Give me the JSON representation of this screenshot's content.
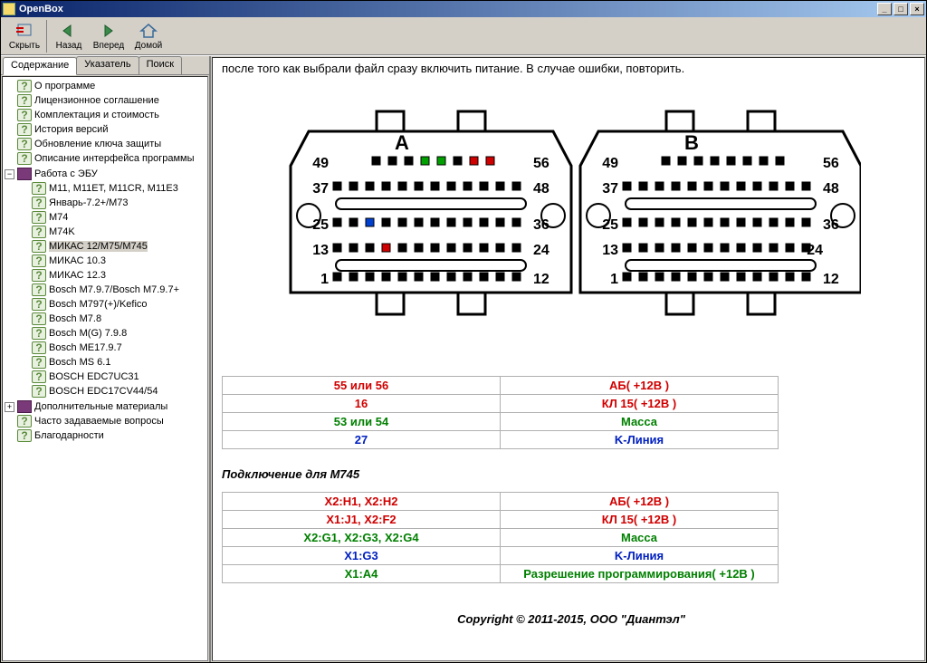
{
  "window": {
    "title": "OpenBox"
  },
  "toolbar": {
    "hide": "Скрыть",
    "back": "Назад",
    "forward": "Вперед",
    "home": "Домой"
  },
  "tabs": {
    "contents": "Содержание",
    "index": "Указатель",
    "search": "Поиск"
  },
  "tree": {
    "about": "О программе",
    "license": "Лицензионное соглашение",
    "pricing": "Комплектация и стоимость",
    "history": "История версий",
    "keyupdate": "Обновление ключа защиты",
    "interface": "Описание интерфейса программы",
    "ecu": "Работа с ЭБУ",
    "m11": "M11, M11ET, M11CR, M11E3",
    "yanvar": "Январь-7.2+/M73",
    "m74": "M74",
    "m74k": "M74K",
    "mikas12": "МИКАС 12/M75/M745",
    "mikas103": "МИКАС 10.3",
    "mikas123": "МИКАС 12.3",
    "bosch797": "Bosch M7.9.7/Bosch M7.9.7+",
    "bosch797k": "Bosch M797(+)/Kefico",
    "boschm78": "Bosch M7.8",
    "boschmg": "Bosch M(G) 7.9.8",
    "boschme": "Bosch ME17.9.7",
    "boschms": "Bosch MS 6.1",
    "edc7": "BOSCH EDC7UC31",
    "edc17": "BOSCH EDC17CV44/54",
    "extra": "Дополнительные материалы",
    "faq": "Часто задаваемые вопросы",
    "thanks": "Благодарности"
  },
  "content": {
    "top_text": "после того как выбрали файл сразу включить питание. В случае ошибки, повторить.",
    "subheader": "Подключение для M745",
    "copyright": "Copyright © 2011-2015, ООО \"Диантэл\""
  },
  "connector": {
    "labelA": "A",
    "labelB": "B",
    "nums": {
      "n49": "49",
      "n56": "56",
      "n37": "37",
      "n48": "48",
      "n25": "25",
      "n36": "36",
      "n13": "13",
      "n24": "24",
      "n1": "1",
      "n12": "12"
    }
  },
  "table1": [
    {
      "pin": "55 или 56",
      "desc": "АБ( +12В )",
      "cls": "red"
    },
    {
      "pin": "16",
      "desc": "КЛ 15( +12В )",
      "cls": "red"
    },
    {
      "pin": "53 или 54",
      "desc": "Масса",
      "cls": "green"
    },
    {
      "pin": "27",
      "desc": "K-Линия",
      "cls": "blue"
    }
  ],
  "table2": [
    {
      "pin": "X2:H1, X2:H2",
      "desc": "АБ( +12В )",
      "cls": "red"
    },
    {
      "pin": "X1:J1, X2:F2",
      "desc": "КЛ 15( +12В )",
      "cls": "red"
    },
    {
      "pin": "X2:G1, X2:G3, X2:G4",
      "desc": "Масса",
      "cls": "green"
    },
    {
      "pin": "X1:G3",
      "desc": "K-Линия",
      "cls": "blue"
    },
    {
      "pin": "X1:A4",
      "desc": "Разрешение программирования( +12В )",
      "cls": "green"
    }
  ]
}
